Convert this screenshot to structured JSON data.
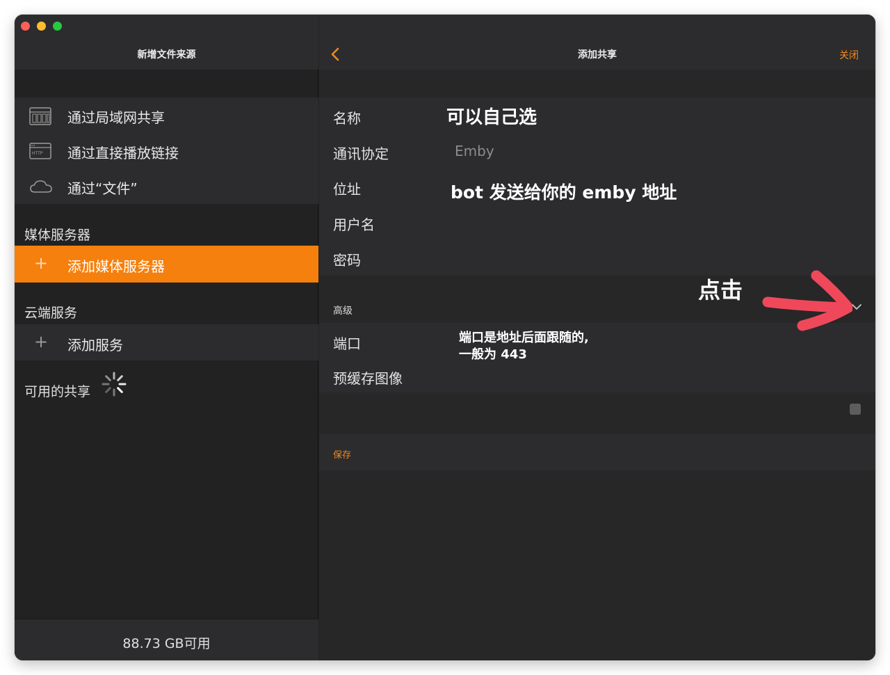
{
  "sidebar": {
    "title": "新增文件来源",
    "file_sources": [
      {
        "label": "通过局域网共享",
        "icon": "nas-server-icon"
      },
      {
        "label": "通过直接播放链接",
        "icon": "http-window-icon"
      },
      {
        "label": "通过“文件”",
        "icon": "cloud-icon"
      }
    ],
    "media_section": "媒体服务器",
    "add_media_server": "添加媒体服务器",
    "cloud_section": "云端服务",
    "add_service": "添加服务",
    "available_shares": "可用的共享",
    "storage_available": "88.73 GB可用"
  },
  "main": {
    "title": "添加共享",
    "close": "关闭",
    "fields": [
      {
        "label": "名称",
        "value": ""
      },
      {
        "label": "通讯协定",
        "value": "Emby"
      },
      {
        "label": "位址",
        "value": ""
      },
      {
        "label": "用户名",
        "value": ""
      },
      {
        "label": "密码",
        "value": ""
      }
    ],
    "advanced_label": "高级",
    "advanced_fields": [
      {
        "label": "端口"
      },
      {
        "label": "预缓存图像",
        "checked": false
      }
    ],
    "save": "保存"
  },
  "annotations": {
    "name_hint": "可以自己选",
    "address_hint": "bot 发送给你的 emby 地址",
    "port_hint_line1": "端口是地址后面跟随的,",
    "port_hint_line2": "一般为 443",
    "click_hint": "点击"
  },
  "colors": {
    "accent": "#f5800d",
    "annotation_arrow": "#f0485b"
  }
}
